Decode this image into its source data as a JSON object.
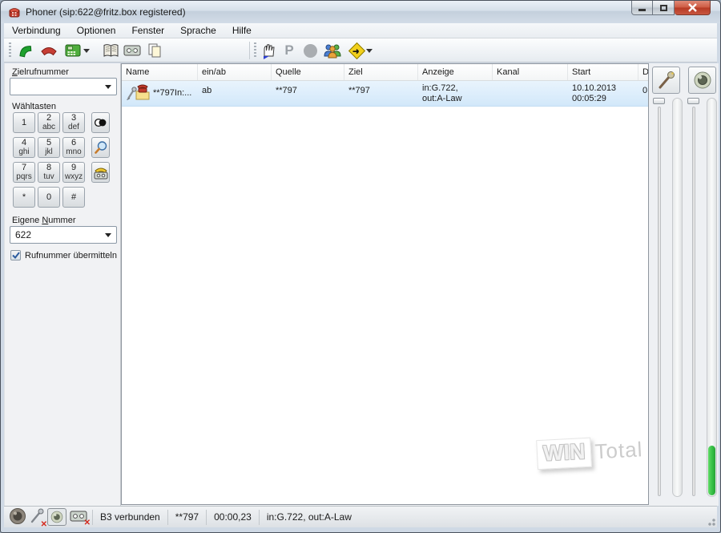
{
  "window": {
    "title": "Phoner (sip:622@fritz.box registered)"
  },
  "menu": {
    "items": [
      {
        "label": "Verbindung"
      },
      {
        "label": "Optionen"
      },
      {
        "label": "Fenster"
      },
      {
        "label": "Sprache"
      },
      {
        "label": "Hilfe"
      }
    ]
  },
  "toolbar": {
    "park_glyph": "P"
  },
  "sidebar": {
    "target_label": {
      "accel": "Z",
      "rest": "ielrufnummer"
    },
    "target_value": "",
    "dialpad_label": "Wähltasten",
    "keys": [
      {
        "digit": "1",
        "letters": ""
      },
      {
        "digit": "2",
        "letters": "abc"
      },
      {
        "digit": "3",
        "letters": "def"
      },
      {
        "digit": "4",
        "letters": "ghi"
      },
      {
        "digit": "5",
        "letters": "jkl"
      },
      {
        "digit": "6",
        "letters": "mno"
      },
      {
        "digit": "7",
        "letters": "pqrs"
      },
      {
        "digit": "8",
        "letters": "tuv"
      },
      {
        "digit": "9",
        "letters": "wxyz"
      },
      {
        "digit": "*",
        "letters": ""
      },
      {
        "digit": "0",
        "letters": ""
      },
      {
        "digit": "#",
        "letters": ""
      }
    ],
    "own_label": {
      "pre": "Eigene ",
      "accel": "N",
      "rest": "ummer"
    },
    "own_value": "622",
    "clip_label": "Rufnummer übermitteln",
    "clip_checked": true
  },
  "table": {
    "columns": [
      {
        "label": "Name"
      },
      {
        "label": "ein/ab"
      },
      {
        "label": "Quelle"
      },
      {
        "label": "Ziel"
      },
      {
        "label": "Anzeige"
      },
      {
        "label": "Kanal"
      },
      {
        "label": "Start"
      },
      {
        "label": "D"
      }
    ],
    "row": {
      "name": "**797In:...",
      "einab": "ab",
      "quelle": "**797",
      "ziel": "**797",
      "anzeige1": "in:G.722,",
      "anzeige2": "out:A-Law",
      "kanal": "",
      "start1": "10.10.2013",
      "start2": "00:05:29",
      "d": "0"
    }
  },
  "watermark": {
    "win": "WIN",
    "total": "Total"
  },
  "status": {
    "connection": "B3 verbunden",
    "number": "**797",
    "duration": "00:00,23",
    "codec": "in:G.722, out:A-Law"
  },
  "colors": {
    "selection": "#d7eafb",
    "meter_green": "#3ecb4e",
    "close_button_red": "#c85640"
  }
}
